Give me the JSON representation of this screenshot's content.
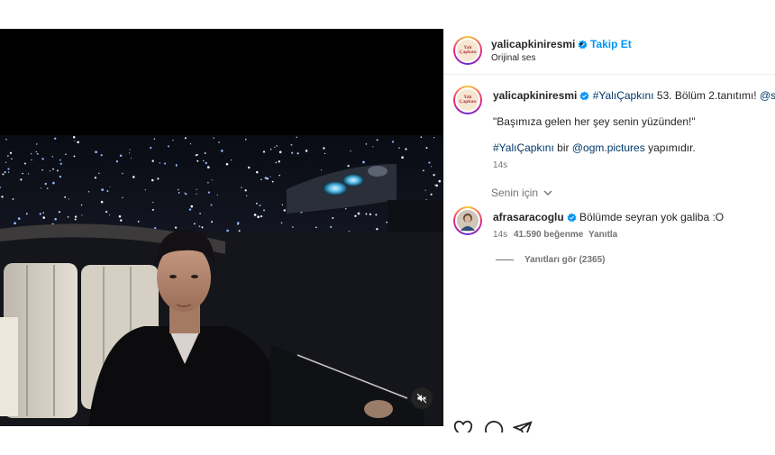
{
  "post": {
    "username": "yalicapkiniresmi",
    "follow_label": "Takip Et",
    "audio_label": "Orijinal ses",
    "avatar_text": "Yalı Çapkını"
  },
  "caption": {
    "username": "yalicapkiniresmi",
    "hashtag": "#YalıÇapkını",
    "text1": " 53. Bölüm 2.tanıtımı! ",
    "mention1": "@startv",
    "quote": "\"Başımıza gelen her şey senin yüzünden!\"",
    "hashtag2": "#YalıÇapkını",
    "text2": " bir ",
    "mention2": "@ogm.pictures",
    "text3": " yapımıdır.",
    "time": "14s"
  },
  "filter": {
    "label": "Senin için"
  },
  "comment": {
    "username": "afrasaracoglu",
    "text": "Bölümde seyran yok galiba :O",
    "time": "14s",
    "likes": "41.590 beğenme",
    "reply_label": "Yanıtla",
    "view_replies": "Yanıtları gör (2365)"
  },
  "colors": {
    "accent": "#0095f6",
    "link": "#00376b",
    "muted": "#737373",
    "verified": "#0095f6"
  },
  "icons": [
    "verified-badge-icon",
    "chevron-down-icon",
    "mute-icon",
    "heart-icon",
    "comment-icon",
    "share-icon"
  ]
}
